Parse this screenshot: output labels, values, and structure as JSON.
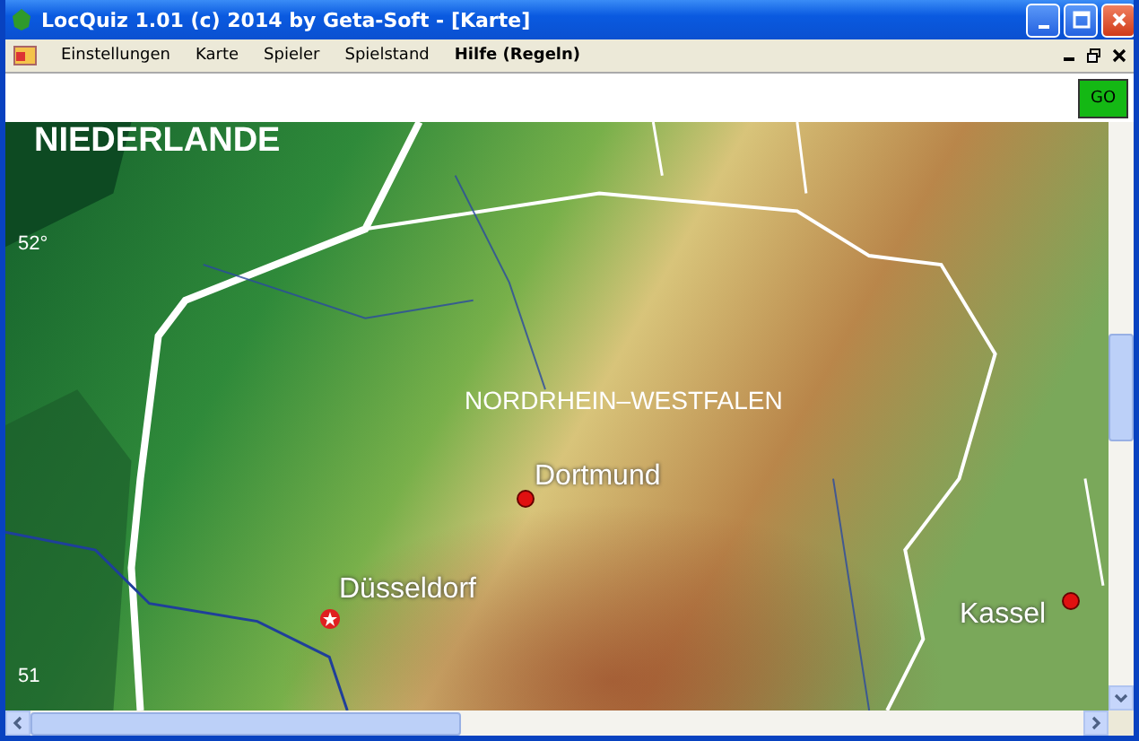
{
  "window": {
    "title": "LocQuiz 1.01 (c) 2014 by Geta-Soft - [Karte]"
  },
  "menu": [
    {
      "label": "Einstellungen",
      "emphasized": false
    },
    {
      "label": "Karte",
      "emphasized": false
    },
    {
      "label": "Spieler",
      "emphasized": false
    },
    {
      "label": "Spielstand",
      "emphasized": false
    },
    {
      "label": "Hilfe (Regeln)",
      "emphasized": true
    }
  ],
  "toolbar": {
    "go_button": "GO"
  },
  "map": {
    "country_label": "NIEDERLANDE",
    "state_label": "NORDRHEIN–WESTFALEN",
    "latitudes": [
      "52°",
      "51"
    ],
    "cities": [
      {
        "name": "Dortmund",
        "kind": "dot"
      },
      {
        "name": "Düsseldorf",
        "kind": "capital"
      },
      {
        "name": "Kassel",
        "kind": "dot"
      }
    ]
  }
}
